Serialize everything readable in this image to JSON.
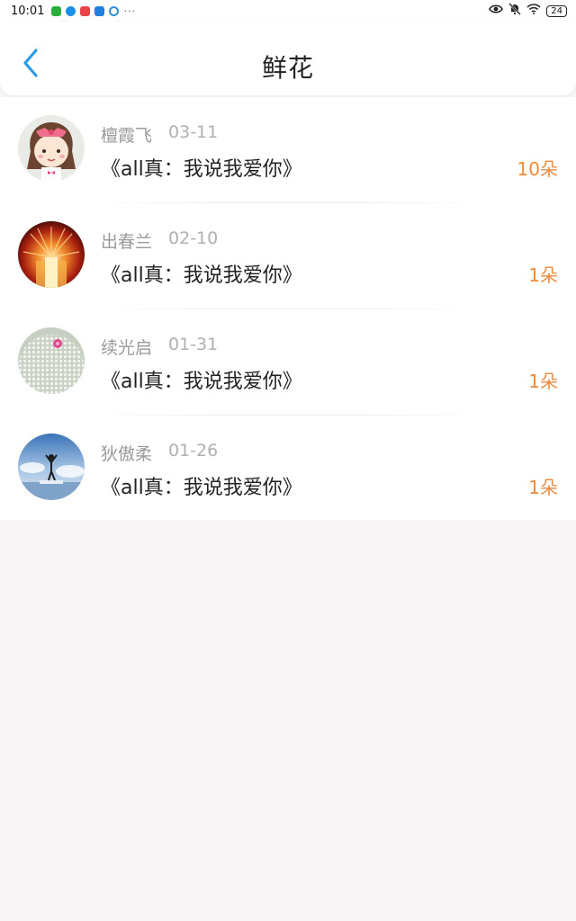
{
  "status_bar": {
    "time": "10:01",
    "dots": "···",
    "battery": "24",
    "app_icons": [
      {
        "name": "wechat-app-icon",
        "color": "#2aae3c"
      },
      {
        "name": "blue-app-icon",
        "color": "#1a8fe8"
      },
      {
        "name": "red-app-icon",
        "color": "#e8434b"
      },
      {
        "name": "cloud-app-icon",
        "color": "#1e7fe0"
      },
      {
        "name": "circle-app-icon",
        "color": "#2b8fd9"
      }
    ]
  },
  "header": {
    "title": "鲜花",
    "back_icon": "chevron-left-icon",
    "accent": "#2e9ae8"
  },
  "flowers": [
    {
      "name": "檀霞飞",
      "date": "03-11",
      "work": "《all真：我说我爱你》",
      "count": "10朵",
      "avatar": "cartoon-girl"
    },
    {
      "name": "出春兰",
      "date": "02-10",
      "work": "《all真：我说我爱你》",
      "count": "1朵",
      "avatar": "fireworks"
    },
    {
      "name": "续光启",
      "date": "01-31",
      "work": "《all真：我说我爱你》",
      "count": "1朵",
      "avatar": "cactus"
    },
    {
      "name": "狄傲柔",
      "date": "01-26",
      "work": "《all真：我说我爱你》",
      "count": "1朵",
      "avatar": "sky-person"
    }
  ],
  "colors": {
    "count": "#ee8a3c",
    "meta": "#9a9a9a",
    "background": "#f7f5f5"
  }
}
